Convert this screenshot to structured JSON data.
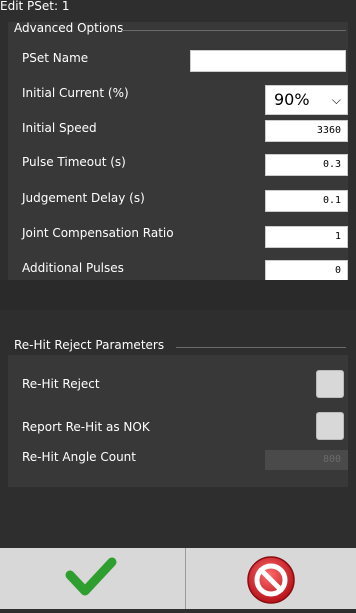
{
  "window": {
    "title": "Edit PSet: 1"
  },
  "advanced": {
    "legend": "Advanced Options",
    "pset_name_label": "PSet Name",
    "pset_name_value": "",
    "initial_current_label": "Initial Current (%)",
    "initial_current_value": "90%",
    "initial_speed_label": "Initial Speed",
    "initial_speed_value": "3360",
    "pulse_timeout_label": "Pulse Timeout (s)",
    "pulse_timeout_value": "0.3",
    "judgement_delay_label": "Judgement Delay (s)",
    "judgement_delay_value": "0.1",
    "joint_comp_label": "Joint Compensation Ratio",
    "joint_comp_value": "1",
    "additional_pulses_label": "Additional Pulses",
    "additional_pulses_value": "0"
  },
  "rehit": {
    "legend": "Re-Hit Reject Parameters",
    "rehit_reject_label": "Re-Hit Reject",
    "report_nok_label": "Report Re-Hit as NOK",
    "angle_count_label": "Re-Hit Angle Count",
    "angle_count_value": "800"
  },
  "footer": {
    "confirm_icon": "checkmark-icon",
    "cancel_icon": "cancel-icon",
    "confirm_color": "#2e9e2e",
    "cancel_color": "#d9272e"
  }
}
